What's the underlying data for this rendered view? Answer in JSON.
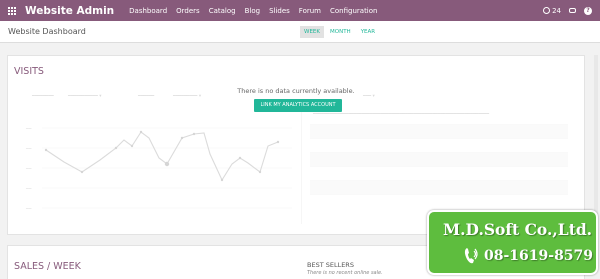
{
  "navbar": {
    "app_title": "Website Admin",
    "menu": [
      "Dashboard",
      "Orders",
      "Catalog",
      "Blog",
      "Slides",
      "Forum",
      "Configuration"
    ],
    "notifications_count": "24"
  },
  "control_panel": {
    "title": "Website Dashboard",
    "ranges": [
      "WEEK",
      "MONTH",
      "YEAR"
    ],
    "active_range": "WEEK"
  },
  "visits": {
    "title": "VISITS",
    "no_data_message": "There is no data currently available.",
    "link_button": "LINK MY ANALYTICS ACCOUNT"
  },
  "sales": {
    "title": "SALES / WEEK",
    "best_sellers_title": "BEST SELLERS",
    "best_sellers_empty": "There is no recent online sale."
  },
  "watermark": {
    "company": "M.D.Soft Co.,Ltd.",
    "phone": "08-1619-8579"
  },
  "colors": {
    "brand": "#875a7b",
    "accent": "#21b799",
    "badge": "#5ebd3e"
  }
}
